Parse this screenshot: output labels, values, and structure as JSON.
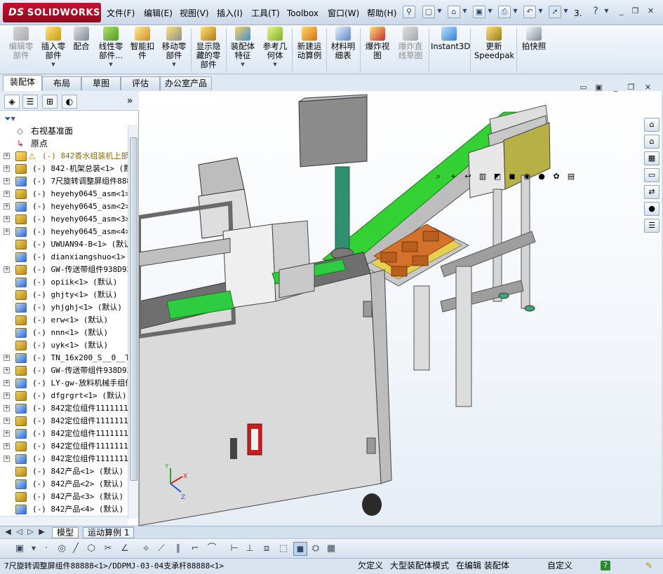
{
  "app": {
    "brand": "SOLIDWORKS",
    "brand_prefix": "DS"
  },
  "menu": [
    "文件(F)",
    "编辑(E)",
    "视图(V)",
    "插入(I)",
    "工具(T)",
    "Toolbox",
    "窗口(W)",
    "帮助(H)"
  ],
  "quick_access": {
    "more": "3."
  },
  "ribbon": [
    {
      "label": [
        "编辑零",
        "部件"
      ],
      "icon": "edit-component-icon",
      "disabled": true
    },
    {
      "label": [
        "插入零",
        "部件"
      ],
      "icon": "insert-component-icon",
      "dropdown": true
    },
    {
      "label": [
        "配合"
      ],
      "icon": "mate-icon"
    },
    {
      "label": [
        "线性零",
        "部件..."
      ],
      "icon": "linear-pattern-icon",
      "dropdown": true
    },
    {
      "label": [
        "智能扣",
        "件"
      ],
      "icon": "smart-fasteners-icon"
    },
    {
      "label": [
        "移动零",
        "部件"
      ],
      "icon": "move-component-icon",
      "dropdown": true
    },
    {
      "label": [
        "显示隐",
        "藏的零",
        "部件"
      ],
      "icon": "show-hidden-icon"
    },
    {
      "label": [
        "装配体",
        "特征"
      ],
      "icon": "assembly-feature-icon",
      "dropdown": true
    },
    {
      "label": [
        "参考几",
        "何体"
      ],
      "icon": "reference-geometry-icon",
      "dropdown": true
    },
    {
      "label": [
        "新建运",
        "动算例"
      ],
      "icon": "new-motion-study-icon"
    },
    {
      "label": [
        "材料明",
        "细表"
      ],
      "icon": "bom-icon"
    },
    {
      "label": [
        "爆炸视",
        "图"
      ],
      "icon": "exploded-view-icon"
    },
    {
      "label": [
        "爆炸直",
        "线草图"
      ],
      "icon": "explode-line-sketch-icon",
      "disabled": true
    },
    {
      "label": [
        "Instant3D"
      ],
      "icon": "instant3d-icon"
    },
    {
      "label": [
        "更新",
        "Speedpak"
      ],
      "icon": "speedpak-icon"
    },
    {
      "label": [
        "拍快照"
      ],
      "icon": "snapshot-icon"
    }
  ],
  "tabs": [
    "装配体",
    "布局",
    "草图",
    "评估",
    "办公室产品"
  ],
  "tree": [
    {
      "text": "右视基准面",
      "kind": "plane"
    },
    {
      "text": "原点",
      "kind": "origin"
    },
    {
      "text": "(-) 842香水组装机上部",
      "kind": "warn"
    },
    {
      "text": "(-) 842-机架总装<1> (默认"
    },
    {
      "text": "(-) 7尺旋转调整屏组件88888"
    },
    {
      "text": "(-) heyehy0645_asm<1> (默"
    },
    {
      "text": "(-) heyehy0645_asm<2> (默"
    },
    {
      "text": "(-) heyehy0645_asm<3> (默"
    },
    {
      "text": "(-) heyehy0645_asm<4> (默"
    },
    {
      "text": "(-) UWUAN94-B<1> (默认)",
      "noexpand": true
    },
    {
      "text": "(-) dianxiangshuo<1> (默",
      "noexpand": true
    },
    {
      "text": "(-) GW-传送带组件938D93"
    },
    {
      "text": "(-) opiik<1> (默认)",
      "noexpand": true
    },
    {
      "text": "(-) ghjty<1> (默认)",
      "noexpand": true
    },
    {
      "text": "(-) yhjghj<1> (默认)",
      "noexpand": true
    },
    {
      "text": "(-) erw<1> (默认)",
      "noexpand": true
    },
    {
      "text": "(-) nnn<1> (默认)",
      "noexpand": true
    },
    {
      "text": "(-) uyk<1> (默认)",
      "noexpand": true
    },
    {
      "text": "(-) TN_16x200_S__0__TN-"
    },
    {
      "text": "(-) GW-传送带组件938D93"
    },
    {
      "text": "(-) LY-gw-放料机械手组件"
    },
    {
      "text": "(-) dfgrgrt<1> (默认)"
    },
    {
      "text": "(-) 842定位组件1111111<"
    },
    {
      "text": "(-) 842定位组件1111111<"
    },
    {
      "text": "(-) 842定位组件1111111<"
    },
    {
      "text": "(-) 842定位组件1111111<"
    },
    {
      "text": "(-) 842定位组件1111111<"
    },
    {
      "text": "(-) 842产品<1> (默认)",
      "noexpand": true
    },
    {
      "text": "(-) 842产品<2> (默认)",
      "noexpand": true
    },
    {
      "text": "(-) 842产品<3> (默认)",
      "noexpand": true
    },
    {
      "text": "(-) 842产品<4> (默认)",
      "noexpand": true
    }
  ],
  "bottom_tabs": [
    "模型",
    "运动算例 1"
  ],
  "status": {
    "path": "7尺旋转调整屏组件88888<1>/DDPMJ-03-04支承杆88888<1>",
    "undefined": "欠定义",
    "mode": "大型装配体模式",
    "editing": "在编辑 装配体",
    "custom": "自定义",
    "help": "?"
  },
  "axes_labels": {
    "x": "X",
    "y": "Y",
    "z": "Z"
  },
  "colors": {
    "accent": "#c8102e",
    "ribbon_bg": "#e6eef8",
    "conveyor_belt": "#33d133",
    "frame_gray": "#c9c9c9",
    "tray_orange": "#d4722c"
  }
}
